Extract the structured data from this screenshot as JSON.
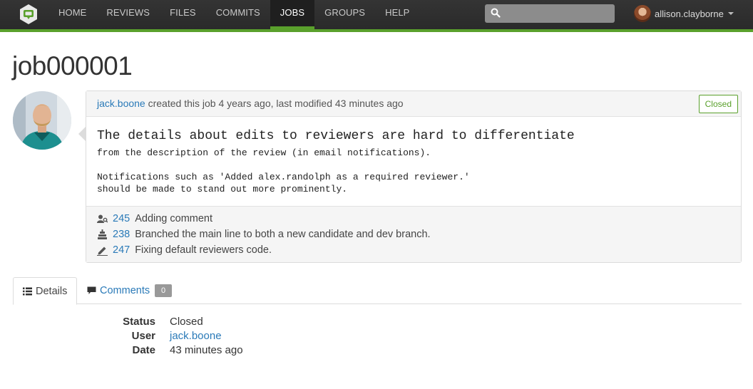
{
  "nav": {
    "items": [
      {
        "label": "HOME",
        "active": false
      },
      {
        "label": "REVIEWS",
        "active": false
      },
      {
        "label": "FILES",
        "active": false
      },
      {
        "label": "COMMITS",
        "active": false
      },
      {
        "label": "JOBS",
        "active": true
      },
      {
        "label": "GROUPS",
        "active": false
      },
      {
        "label": "HELP",
        "active": false
      }
    ],
    "search": {
      "placeholder": "",
      "value": ""
    },
    "user": {
      "name": "allison.clayborne"
    },
    "accent_color": "#5aa02c"
  },
  "page": {
    "title": "job000001"
  },
  "job": {
    "author": "jack.boone",
    "meta_suffix": "created this job 4 years ago, last modified 43 minutes ago",
    "status": "Closed",
    "description": {
      "title": "The details about edits to reviewers are hard to differentiate",
      "lines": [
        "from the description of the review (in email notifications).",
        "",
        "Notifications such as 'Added alex.randolph as a required reviewer.'",
        "should be made to stand out more prominently."
      ]
    },
    "changes": [
      {
        "icon": "review-icon",
        "id": "245",
        "text": "Adding comment"
      },
      {
        "icon": "commit-icon",
        "id": "238",
        "text": "Branched the main line to both a new candidate and dev branch."
      },
      {
        "icon": "pending-edit-icon",
        "id": "247",
        "text": "Fixing default reviewers code."
      }
    ]
  },
  "tabs": {
    "details": {
      "label": "Details",
      "icon": "list-icon"
    },
    "comments": {
      "label": "Comments",
      "icon": "comment-icon",
      "count": "0"
    }
  },
  "details": {
    "rows": [
      {
        "label": "Status",
        "value": "Closed"
      },
      {
        "label": "User",
        "value": "jack.boone"
      },
      {
        "label": "Date",
        "value": "43 minutes ago"
      }
    ]
  }
}
